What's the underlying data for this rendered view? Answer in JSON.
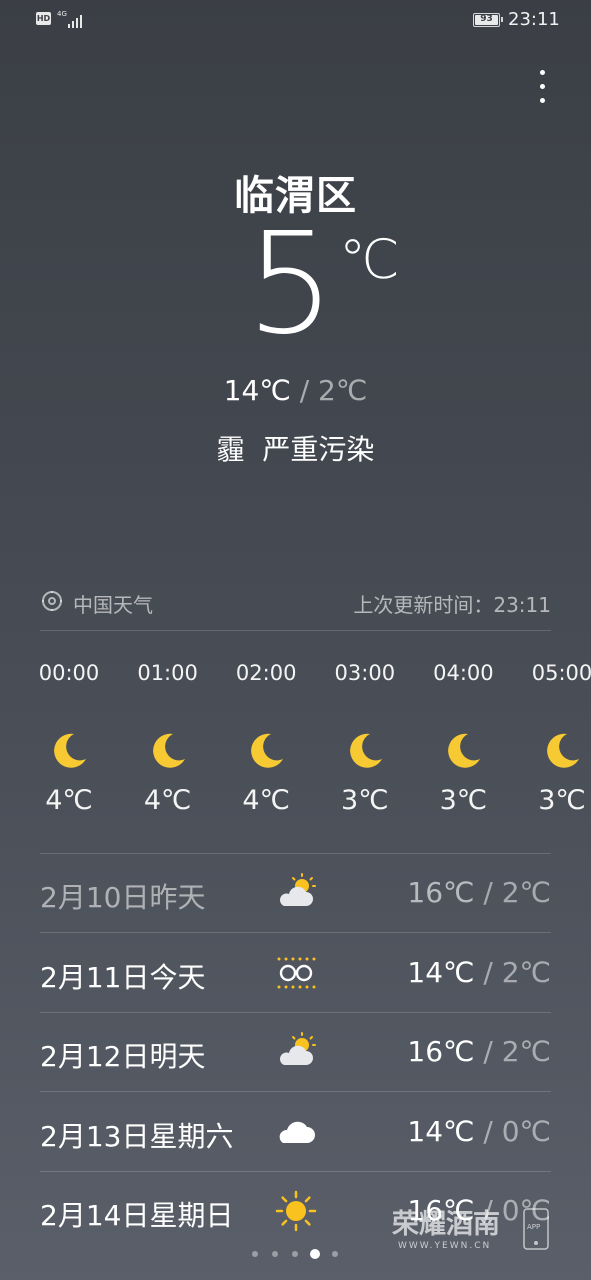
{
  "status_bar": {
    "hd_badge": "HD",
    "network": "4G",
    "battery_level": "93",
    "time": "23:11"
  },
  "location": {
    "city": "临渭区"
  },
  "current": {
    "temperature": "5",
    "unit": "℃",
    "high": "14℃",
    "separator": "/",
    "low": "2℃",
    "condition": "霾  严重污染"
  },
  "source": {
    "name": "中国天气",
    "update_text": "上次更新时间：23:11"
  },
  "hourly": [
    {
      "time": "00:00",
      "icon": "moon-icon",
      "temp": "4℃"
    },
    {
      "time": "01:00",
      "icon": "moon-icon",
      "temp": "4℃"
    },
    {
      "time": "02:00",
      "icon": "moon-icon",
      "temp": "4℃"
    },
    {
      "time": "03:00",
      "icon": "moon-icon",
      "temp": "3℃"
    },
    {
      "time": "04:00",
      "icon": "moon-icon",
      "temp": "3℃"
    },
    {
      "time": "05:00",
      "icon": "moon-icon",
      "temp": "3℃"
    }
  ],
  "daily": [
    {
      "label": "2月10日昨天",
      "icon": "partly-cloudy-icon",
      "high": "16℃",
      "low": "2℃"
    },
    {
      "label": "2月11日今天",
      "icon": "haze-icon",
      "high": "14℃",
      "low": "2℃"
    },
    {
      "label": "2月12日明天",
      "icon": "partly-cloudy-icon",
      "high": "16℃",
      "low": "2℃"
    },
    {
      "label": "2月13日星期六",
      "icon": "cloudy-icon",
      "high": "14℃",
      "low": "0℃"
    },
    {
      "label": "2月14日星期日",
      "icon": "sunny-icon",
      "high": "16℃",
      "low": "0℃"
    }
  ],
  "pager": {
    "count": 5,
    "active_index": 3
  },
  "watermark": {
    "brand": "荣耀酒南",
    "domain": "WWW.YEWN.CN",
    "app_label": "APP"
  },
  "colors": {
    "background": "#434850",
    "moon": "#f7c932",
    "sun": "#f9c21f",
    "text": "#ffffff"
  }
}
